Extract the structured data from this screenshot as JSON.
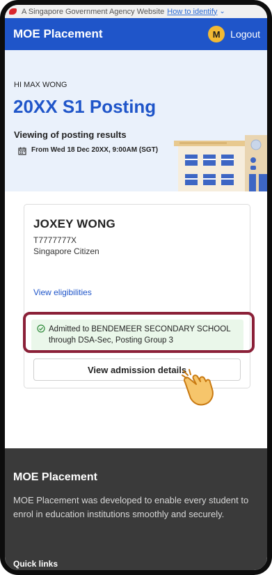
{
  "gov_banner": {
    "text": "A Singapore Government Agency Website",
    "link": "How to identify"
  },
  "nav": {
    "brand": "MOE Placement",
    "avatar_initial": "M",
    "logout": "Logout"
  },
  "hero": {
    "greeting": "HI MAX WONG",
    "title": "20XX S1 Posting",
    "viewing_label": "Viewing of posting results",
    "date_text": "From Wed 18 Dec 20XX, 9:00AM (SGT)"
  },
  "student": {
    "name": "JOXEY WONG",
    "id": "T7777777X",
    "citizenship": "Singapore Citizen",
    "view_eligibilities": "View eligibilities",
    "status": "Admitted to BENDEMEER SECONDARY SCHOOL through DSA-Sec, Posting Group 3",
    "view_admission": "View admission details"
  },
  "footer": {
    "title": "MOE Placement",
    "description": "MOE Placement was developed to enable every student to enrol in education institutions smoothly and securely.",
    "quick_links": "Quick links"
  },
  "colors": {
    "primary": "#1f55c9",
    "avatar": "#f2b934",
    "highlight": "#8b2038",
    "success_bg": "#eaf7ea",
    "footer_bg": "#3a3a3a"
  },
  "icons": [
    "lion-head-icon",
    "chevron-down-icon",
    "calendar-icon",
    "check-circle-icon",
    "pointing-hand-icon"
  ]
}
